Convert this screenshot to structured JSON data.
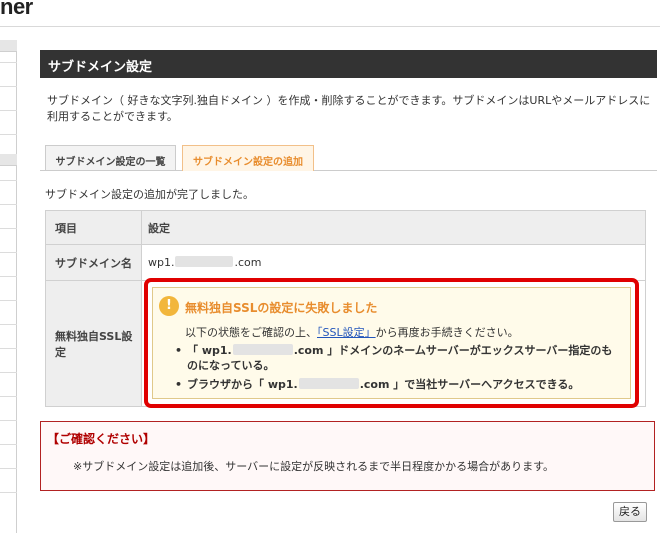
{
  "logo": {
    "text": "ner"
  },
  "panel": {
    "title": "サブドメイン設定",
    "description": "サブドメイン（ 好きな文字列.独自ドメイン ）を作成・削除することができます。サブドメインはURLやメールアドレスに利用することができます。"
  },
  "tabs": [
    {
      "label": "サブドメイン設定の一覧",
      "active": false
    },
    {
      "label": "サブドメイン設定の追加",
      "active": true
    }
  ],
  "done_message": "サブドメイン設定の追加が完了しました。",
  "table": {
    "headers": {
      "item": "項目",
      "setting": "設定"
    },
    "subdomain_label": "サブドメイン名",
    "subdomain_prefix": "wp1.",
    "subdomain_suffix": ".com",
    "ssl_label": "無料独自SSL設定"
  },
  "warning": {
    "icon": "exclamation-icon",
    "title": "無料独自SSLの設定に失敗しました",
    "sub_before": "以下の状態をご確認の上、",
    "sub_link": "「SSL設定」",
    "sub_after": "から再度お手続きください。",
    "item1_before": "「 wp1.",
    "item1_after": ".com 」ドメインのネームサーバーがエックスサーバー指定のものになっている。",
    "item2_before": "ブラウザから「 wp1.",
    "item2_after": ".com 」で当社サーバーへアクセスできる。"
  },
  "notice": {
    "title": "【ご確認ください】",
    "body": "※サブドメイン設定は追加後、サーバーに設定が反映されるまで半日程度かかる場合があります。"
  },
  "back_button": "戻る",
  "colors": {
    "title_bar": "#333333",
    "active_tab": "#e88d2e",
    "highlight_border": "#e00000",
    "warning_bg": "#fffbea",
    "notice_title": "#b00000"
  }
}
